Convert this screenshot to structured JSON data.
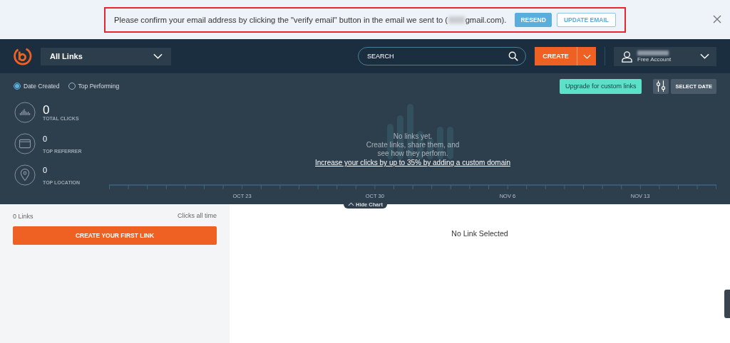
{
  "banner": {
    "message_before": "Please confirm your email address by clicking the \"verify email\" button in the email we sent to (",
    "message_after": "gmail.com).",
    "buttons": [
      {
        "label": "RESEND",
        "kind": "primary"
      },
      {
        "label": "UPDATE EMAIL",
        "kind": "outline"
      }
    ]
  },
  "header": {
    "links_dropdown": "All Links",
    "search": {
      "placeholder": "SEARCH"
    },
    "create_button": "CREATE",
    "account": {
      "plan": "Free Account"
    }
  },
  "chart_panel": {
    "sort_options": [
      {
        "label": "Date Created",
        "selected": true
      },
      {
        "label": "Top Performing",
        "selected": false
      }
    ],
    "upgrade_button": "Upgrade for custom links",
    "select_date_button": "SELECT DATE",
    "stats": [
      {
        "kind": "clicks",
        "value": "0",
        "label": "TOTAL CLICKS"
      },
      {
        "kind": "referrer",
        "value": "0",
        "label": "TOP REFERRER"
      },
      {
        "kind": "location",
        "value": "0",
        "label": "TOP LOCATION"
      }
    ],
    "empty_lines": [
      "No links yet.",
      "Create links, share them, and",
      "see how they perform."
    ],
    "promo_link": "Increase your clicks by up to 35% by adding a custom domain",
    "axis_labels": [
      "OCT 23",
      "OCT 30",
      "NOV 6",
      "NOV 13"
    ],
    "hide_chart": "Hide Chart"
  },
  "links_panel": {
    "count": "0 Links",
    "sort": "Clicks all time",
    "create_first": "CREATE YOUR FIRST LINK"
  },
  "detail": {
    "empty": "No Link Selected"
  }
}
